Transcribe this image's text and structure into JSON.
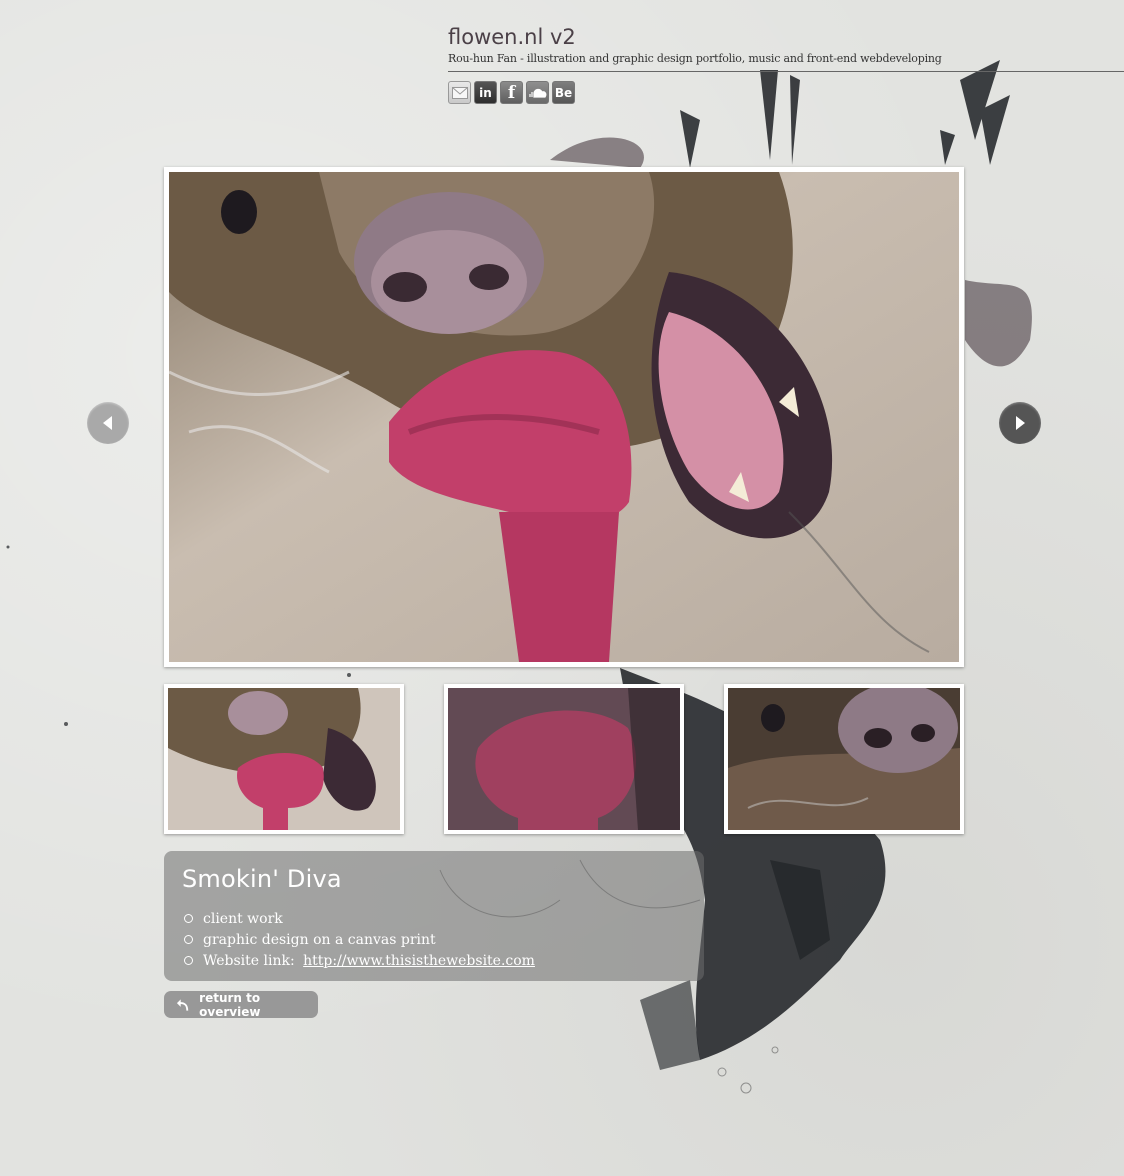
{
  "header": {
    "site_title": "flowen.nl v2",
    "tagline": "Rou-hun Fan - illustration and graphic design portfolio, music and front-end webdeveloping"
  },
  "social": [
    {
      "icon": "mail-icon",
      "label": ""
    },
    {
      "icon": "linkedin-icon",
      "label": "in"
    },
    {
      "icon": "facebook-icon",
      "label": "f"
    },
    {
      "icon": "soundcloud-icon",
      "label": ""
    },
    {
      "icon": "behance-icon",
      "label": "Be"
    }
  ],
  "gallery": {
    "main_image": {
      "subject": "dog-with-toy-artwork"
    },
    "thumbnails": [
      {
        "subject": "dog-with-toy-artwork"
      },
      {
        "subject": "toy-closeup-crop"
      },
      {
        "subject": "dog-face-crop"
      }
    ],
    "prev_icon": "chevron-left-icon",
    "next_icon": "chevron-right-icon"
  },
  "project": {
    "title": "Smokin' Diva",
    "items": [
      {
        "text": "client work"
      },
      {
        "text": "graphic design on a canvas print"
      },
      {
        "text": "Website link: ",
        "link_text": "http://www.thisisthewebsite.com"
      }
    ]
  },
  "return_button": {
    "label": "return to overview",
    "icon": "return-arrow-icon"
  },
  "colors": {
    "background": "#e2e3e0",
    "toy_pink": "#c23f6a",
    "arrow_light": "#a9a9a9",
    "arrow_dark": "#555555",
    "panel": "#6e6e6e"
  }
}
